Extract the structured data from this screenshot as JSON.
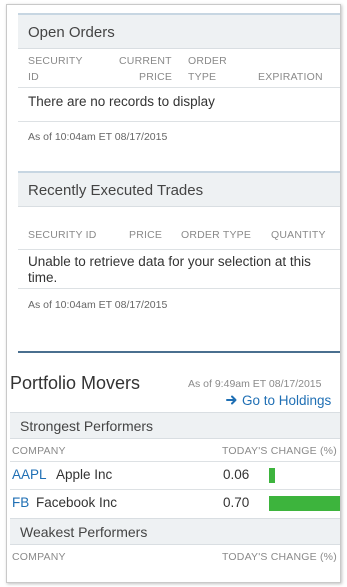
{
  "open_orders": {
    "title": "Open Orders",
    "columns": [
      "SECURITY",
      "ID",
      "CURRENT",
      "PRICE",
      "ORDER",
      "TYPE",
      "EXPIRATION"
    ],
    "empty_message": "There are no records to display",
    "as_of": "As of 10:04am ET 08/17/2015"
  },
  "recent_trades": {
    "title": "Recently Executed Trades",
    "columns": [
      "SECURITY ID",
      "PRICE",
      "ORDER TYPE",
      "QUANTITY"
    ],
    "error_line1": "Unable to retrieve data for your selection at this",
    "error_line2": "time.",
    "as_of": "As of 10:04am ET 08/17/2015"
  },
  "portfolio_movers": {
    "title": "Portfolio Movers",
    "as_of": "As of 9:49am ET 08/17/2015",
    "holdings_link": "Go to Holdings",
    "strongest": {
      "title": "Strongest Performers",
      "col_company": "COMPANY",
      "col_change": "TODAY'S CHANGE (%)",
      "rows": [
        {
          "ticker": "AAPL",
          "name": "Apple Inc",
          "change": "0.06",
          "change_value": 0.06
        },
        {
          "ticker": "FB",
          "name": "Facebook Inc",
          "change": "0.70",
          "change_value": 0.7
        }
      ]
    },
    "weakest": {
      "title": "Weakest Performers",
      "col_company": "COMPANY",
      "col_change": "TODAY'S CHANGE (%)"
    }
  },
  "colors": {
    "accent": "#1f6fb4",
    "bar": "#3db43d",
    "section_bg": "#eef1f3",
    "divider": "#4a6f8f"
  },
  "icons": {
    "holdings_link": "arrow-right-icon"
  }
}
